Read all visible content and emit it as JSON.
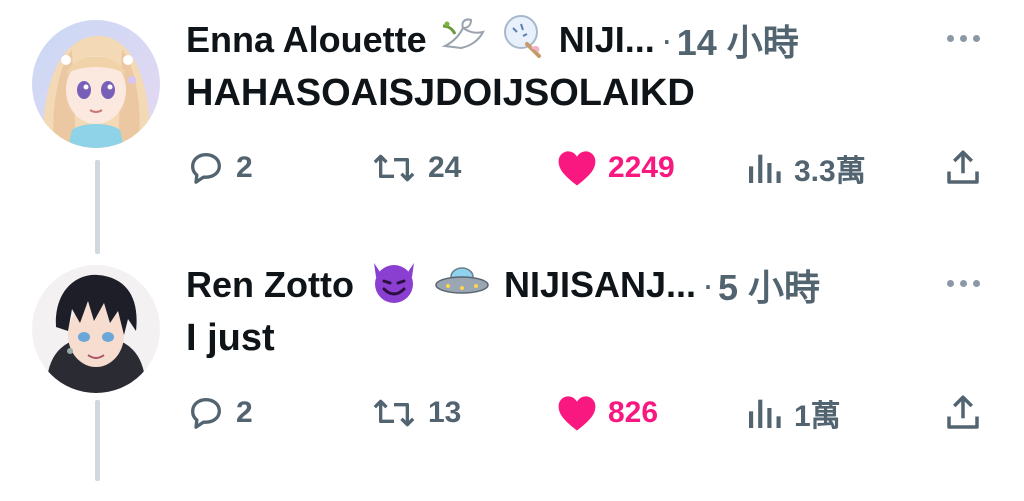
{
  "tweets": [
    {
      "author_name": "Enna Alouette",
      "emojis": [
        "dove-emoji",
        "folding-fan-emoji"
      ],
      "handle": "NIJI...",
      "time": "14 小時",
      "text": "HAHASOAISJDOIJSOLAIKD",
      "replies": "2",
      "retweets": "24",
      "likes": "2249",
      "views": "3.3萬",
      "liked": true
    },
    {
      "author_name": "Ren Zotto",
      "emojis": [
        "smiling-devil-emoji",
        "flying-saucer-emoji"
      ],
      "handle": "NIJISANJ...",
      "time": "5 小時",
      "text": "I just",
      "replies": "2",
      "retweets": "13",
      "likes": "826",
      "views": "1萬",
      "liked": true
    }
  ],
  "colors": {
    "like": "#f91880",
    "secondary": "#536471",
    "thread_line": "#cfd9de"
  }
}
